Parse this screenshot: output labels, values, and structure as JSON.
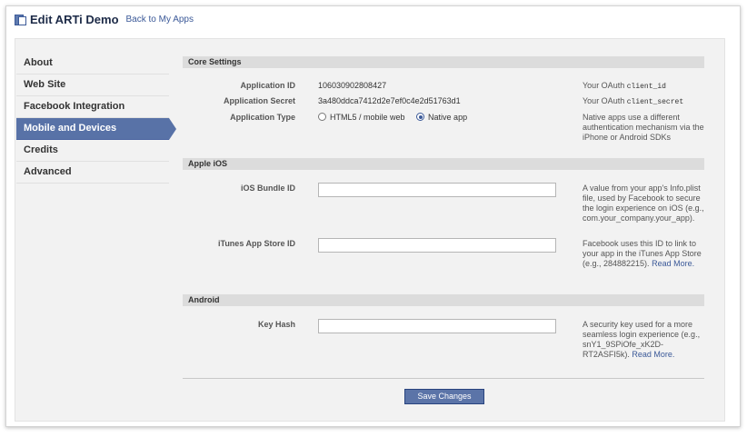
{
  "header": {
    "title": "Edit ARTi Demo",
    "back_link": "Back to My Apps"
  },
  "sidebar": {
    "items": [
      {
        "label": "About"
      },
      {
        "label": "Web Site"
      },
      {
        "label": "Facebook Integration"
      },
      {
        "label": "Mobile and Devices"
      },
      {
        "label": "Credits"
      },
      {
        "label": "Advanced"
      }
    ],
    "active": "Mobile and Devices"
  },
  "core_settings": {
    "section_title": "Core Settings",
    "app_id_label": "Application ID",
    "app_id_value": "106030902808427",
    "app_id_help_prefix": "Your OAuth",
    "app_id_help_code": "client_id",
    "secret_label": "Application Secret",
    "secret_value": "3a480ddca7412d2e7ef0c4e2d51763d1",
    "secret_help_prefix": "Your OAuth",
    "secret_help_code": "client_secret",
    "type_label": "Application Type",
    "type_option_1": "HTML5 / mobile web",
    "type_option_2": "Native app",
    "type_selected": "Native app",
    "type_help": "Native apps use a different authentication mechanism via the iPhone or Android SDKs"
  },
  "apple_ios": {
    "section_title": "Apple iOS",
    "bundle_label": "iOS Bundle ID",
    "bundle_value": "",
    "bundle_help": "A value from your app's Info.plist file, used by Facebook to secure the login experience on iOS (e.g., com.your_company.your_app).",
    "store_label": "iTunes App Store ID",
    "store_value": "",
    "store_help": "Facebook uses this ID to link to your app in the iTunes App Store (e.g., 284882215).",
    "store_help_link": "Read More."
  },
  "android": {
    "section_title": "Android",
    "key_hash_label": "Key Hash",
    "key_hash_value": "",
    "key_hash_help": "A security key used for a more seamless login experience (e.g., snY1_9SPiOfe_xK2D-RT2ASFI5k).",
    "key_hash_help_link": "Read More."
  },
  "actions": {
    "save_label": "Save Changes"
  },
  "colors": {
    "brand": "#3b5998",
    "active_nav": "#5872a7"
  }
}
